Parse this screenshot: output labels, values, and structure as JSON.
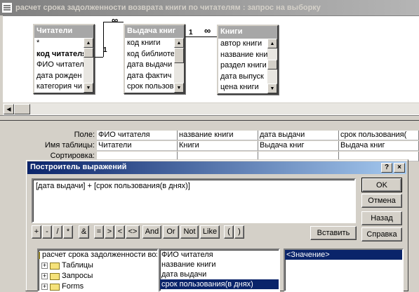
{
  "window": {
    "title": "расчет срока задолженности возврата книги по читателям : запрос на выборку"
  },
  "tables": {
    "readers": {
      "title": "Читатели",
      "fields": [
        "*",
        "код читателя",
        "ФИО читателя",
        "дата рожден",
        "категория чи"
      ]
    },
    "issues": {
      "title": "Выдача книг",
      "fields": [
        "код книги",
        "код библиоте",
        "дата выдачи",
        "дата фактич",
        "срок пользов"
      ]
    },
    "books": {
      "title": "Книги",
      "fields": [
        "автор книги",
        "название книги",
        "раздел книги",
        "дата выпуск",
        "цена книги"
      ]
    }
  },
  "relations": {
    "readers_issues": {
      "one": "1",
      "many": "∞"
    },
    "books_issues": {
      "one": "1",
      "many": "∞"
    }
  },
  "grid": {
    "row_labels": {
      "field": "Поле:",
      "table": "Имя таблицы:",
      "sort": "Сортировка:"
    },
    "columns": [
      {
        "field": "ФИО читателя",
        "table": "Читатели"
      },
      {
        "field": "название книги",
        "table": "Книги"
      },
      {
        "field": "дата выдачи",
        "table": "Выдача книг"
      },
      {
        "field": "срок пользования(",
        "table": "Выдача книг"
      }
    ]
  },
  "dialog": {
    "title": "Построитель выражений",
    "help_glyph": "?",
    "close_glyph": "×",
    "expression": "[дата выдачи] + [срок пользования(в днях)]",
    "buttons": {
      "ok": "OK",
      "cancel": "Отмена",
      "back": "Назад",
      "help": "Справка",
      "paste": "Вставить"
    },
    "operators": [
      "+",
      "-",
      "/",
      "*",
      "&",
      "=",
      ">",
      "<",
      "<>",
      "And",
      "Or",
      "Not",
      "Like",
      "(",
      ")"
    ],
    "tree": [
      {
        "label": "расчет срока задолженности возврата",
        "type": "open"
      },
      {
        "label": "Таблицы",
        "type": "closed"
      },
      {
        "label": "Запросы",
        "type": "closed"
      },
      {
        "label": "Forms",
        "type": "closed"
      }
    ],
    "fields": [
      "ФИО читателя",
      "название книги",
      "дата выдачи",
      "срок пользования(в днях)"
    ],
    "selected_field": "срок пользования(в днях)",
    "values": [
      "<Значение>"
    ]
  },
  "colors": {
    "dialog_title": "#0a246a",
    "inactive_title": "#808080",
    "face": "#d4d0c8",
    "selection": "#0a246a"
  }
}
